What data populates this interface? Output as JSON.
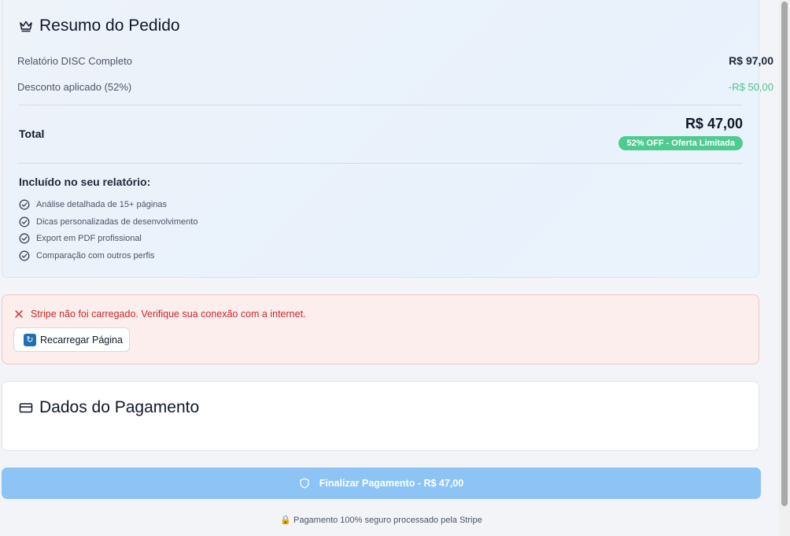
{
  "summary": {
    "title": "Resumo do Pedido",
    "icon": "crown-icon",
    "item_label": "Relatório DISC Completo",
    "item_price": "R$ 97,00",
    "discount_label": "Desconto aplicado (52%)",
    "discount_value": "-R$ 50,00",
    "total_label": "Total",
    "total_value": "R$ 47,00",
    "badge": "52% OFF - Oferta Limitada",
    "included_title": "Incluído no seu relatório:",
    "features": [
      "Análise detalhada de 15+ páginas",
      "Dicas personalizadas de desenvolvimento",
      "Export em PDF profissional",
      "Comparação com outros perfis"
    ]
  },
  "error": {
    "message": "Stripe não foi carregado. Verifique sua conexão com a internet.",
    "reload_button": "Recarregar Página"
  },
  "payment": {
    "title": "Dados do Pagamento",
    "icon": "credit-card-icon"
  },
  "pay_button": {
    "label": "Finalizar Pagamento - R$ 47,00",
    "icon": "shield-icon"
  },
  "secure_note": {
    "icon": "lock-icon",
    "text": "Pagamento 100% seguro processado pela Stripe"
  },
  "colors": {
    "accent_green": "#4fca91",
    "error_red": "#c62828",
    "button_blue": "#8dc4f5"
  }
}
